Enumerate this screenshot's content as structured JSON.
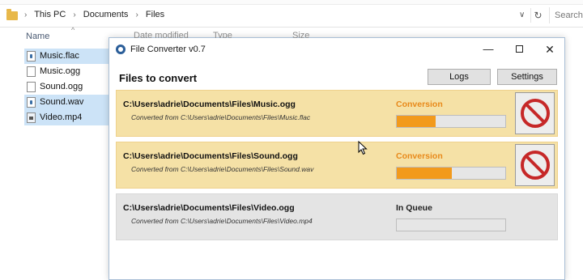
{
  "explorer": {
    "breadcrumbs": [
      "This PC",
      "Documents",
      "Files"
    ],
    "search_placeholder": "Search Files",
    "columns": {
      "name": "Name"
    },
    "files": [
      {
        "name": "Music.flac",
        "icon": "audio-file-icon",
        "selected": true
      },
      {
        "name": "Music.ogg",
        "icon": "blank-file-icon",
        "selected": false
      },
      {
        "name": "Sound.ogg",
        "icon": "blank-file-icon",
        "selected": false
      },
      {
        "name": "Sound.wav",
        "icon": "audio-file-icon",
        "selected": true
      },
      {
        "name": "Video.mp4",
        "icon": "video-file-icon",
        "selected": true
      }
    ],
    "hidden_headers": [
      "Date modified",
      "Type",
      "Size"
    ]
  },
  "window": {
    "title": "File Converter v0.7",
    "heading": "Files to convert",
    "buttons": {
      "logs": "Logs",
      "settings": "Settings"
    },
    "items": [
      {
        "path": "C:\\Users\\adrie\\Documents\\Files\\Music.ogg",
        "from": "Converted from C:\\Users\\adrie\\Documents\\Files\\Music.flac",
        "status": "Conversion",
        "state": "active",
        "progress": 0.36
      },
      {
        "path": "C:\\Users\\adrie\\Documents\\Files\\Sound.ogg",
        "from": "Converted from C:\\Users\\adrie\\Documents\\Files\\Sound.wav",
        "status": "Conversion",
        "state": "active",
        "progress": 0.51
      },
      {
        "path": "C:\\Users\\adrie\\Documents\\Files\\Video.ogg",
        "from": "Converted from C:\\Users\\adrie\\Documents\\Files\\Video.mp4",
        "status": "In Queue",
        "state": "queued",
        "progress": 0
      }
    ]
  },
  "colors": {
    "active_bg": "#f5e1a6",
    "queued_bg": "#e4e4e4",
    "progress": "#f29a1c",
    "status_active": "#e8891a",
    "cancel_icon": "#c62828"
  }
}
